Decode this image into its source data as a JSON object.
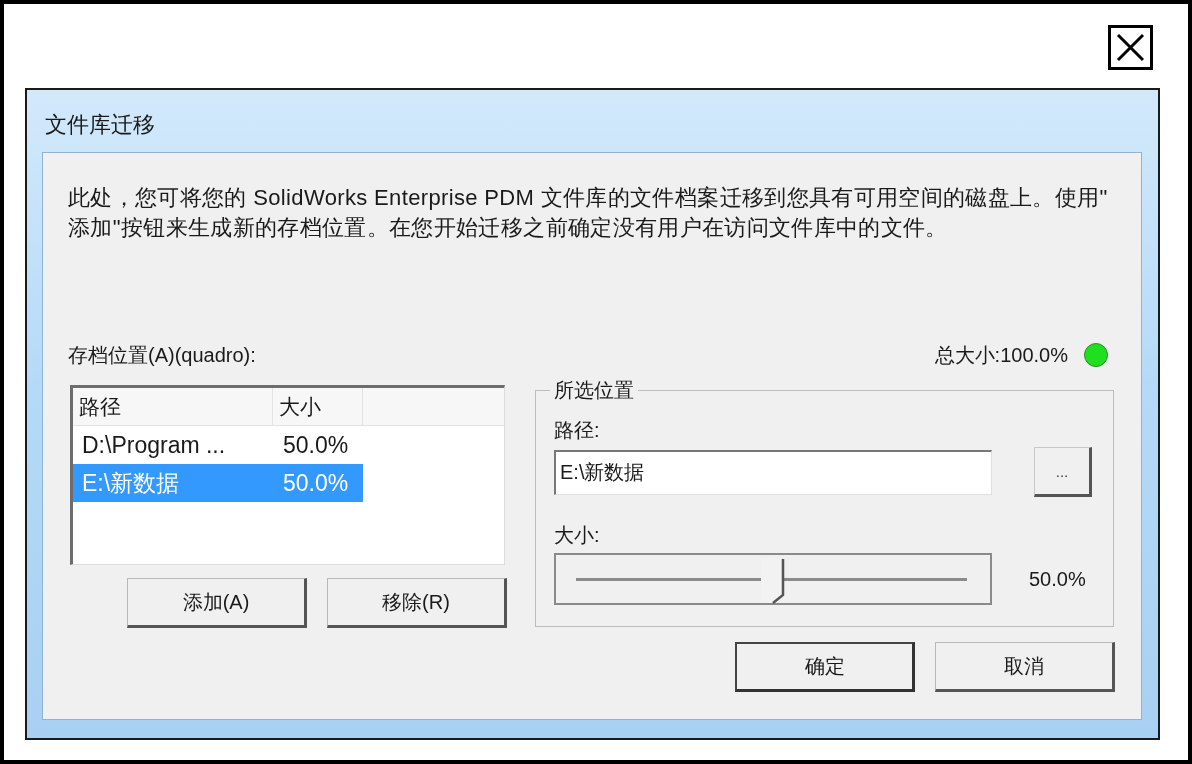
{
  "window": {
    "title": "文件库迁移"
  },
  "description": "此处，您可将您的 SolidWorks Enterprise PDM 文件库的文件档案迁移到您具有可用空间的磁盘上。使用\"添加\"按钮来生成新的存档位置。在您开始迁移之前确定没有用户在访问文件库中的文件。",
  "archive_locations": {
    "label": "存档位置(A)(quadro):",
    "columns": [
      "路径",
      "大小"
    ],
    "rows": [
      {
        "path": "D:\\Program ...",
        "size": "50.0%",
        "selected": false
      },
      {
        "path": "E:\\新数据",
        "size": "50.0%",
        "selected": true
      }
    ],
    "buttons": [
      "添加(A)",
      "移除(R)"
    ]
  },
  "total": {
    "label": "总大小:100.0%",
    "ok": true
  },
  "selected_location": {
    "title": "所选位置",
    "path_label": "路径:",
    "path_value": "E:\\新数据",
    "browse_button": "...",
    "size_label": "大小:",
    "size_slider": {
      "level": 0.5
    },
    "size_reading": "50.0%"
  },
  "buttons": [
    {
      "label": "确定",
      "default": true
    },
    {
      "label": "取消",
      "default": false
    }
  ]
}
